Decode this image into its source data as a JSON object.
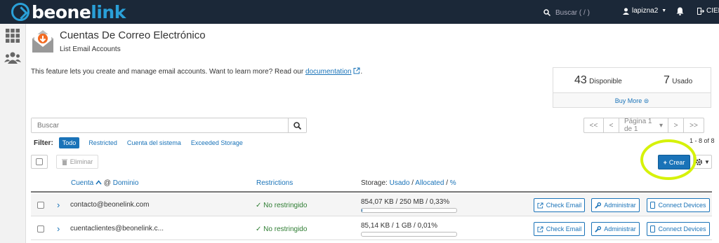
{
  "brand": {
    "logo_a": "beone",
    "logo_b": "link"
  },
  "topbar": {
    "search_placeholder": "Buscar ( / )",
    "user": "lapizna2",
    "logout": "CIER"
  },
  "page": {
    "title": "Cuentas De Correo Electrónico",
    "subtitle": "List Email Accounts"
  },
  "intro": {
    "text": "This feature lets you create and manage email accounts. Want to learn more? Read our ",
    "link": "documentation",
    "end": "."
  },
  "stats": {
    "available_num": "43",
    "available_label": "Disponible",
    "used_num": "7",
    "used_label": "Usado",
    "buy_more": "Buy More"
  },
  "search": {
    "placeholder": "Buscar"
  },
  "pager": {
    "first": "<<",
    "prev": "<",
    "page": "Página 1 de 1",
    "next": ">",
    "last": ">>"
  },
  "filter": {
    "label": "Filter:",
    "options": [
      "Todo",
      "Restricted",
      "Cuenta del sistema",
      "Exceeded Storage"
    ]
  },
  "count": "1 - 8 of 8",
  "toolbar": {
    "delete": "Eliminar",
    "create": "Crear"
  },
  "table": {
    "col_account": "Cuenta",
    "col_at": " @ ",
    "col_domain": "Dominio",
    "col_restrictions": "Restrictions",
    "col_storage": "Storage: ",
    "col_used": "Usado",
    "col_sep": " / ",
    "col_alloc": "Allocated",
    "col_sep2": " / ",
    "col_pct": "%",
    "rows": [
      {
        "email": "contacto@beonelink.com",
        "restriction": "No restringido",
        "storage": "854,07 KB / 250 MB / 0,33%",
        "pct": 0.33
      },
      {
        "email": "cuentaclientes@beonelink.c...",
        "restriction": "No restringido",
        "storage": "85,14 KB / 1 GB / 0,01%",
        "pct": 0.01
      }
    ],
    "btn_check": "Check Email",
    "btn_admin": "Administrar",
    "btn_devices": "Connect Devices"
  },
  "colors": {
    "accent": "#1a73b8",
    "topbar": "#1b2838",
    "highlight": "#d6f20a",
    "ok": "#2e7d32"
  }
}
